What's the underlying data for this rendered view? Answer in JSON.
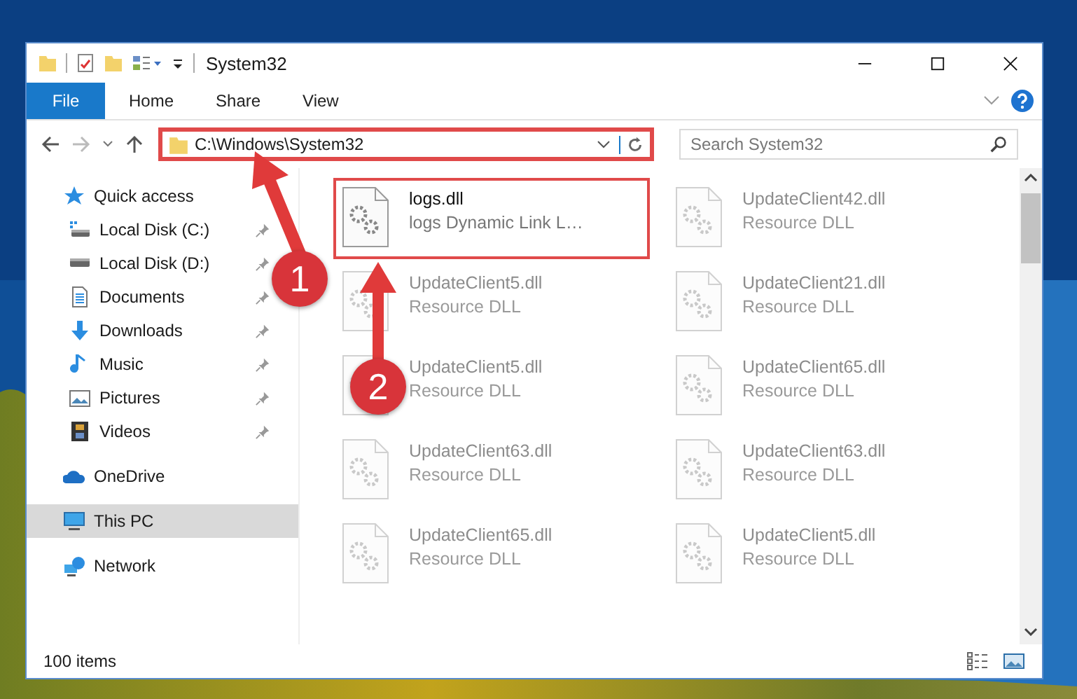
{
  "window": {
    "title": "System32"
  },
  "ribbon_tabs": [
    {
      "label": "File",
      "kind": "file"
    },
    {
      "label": "Home",
      "kind": "tab"
    },
    {
      "label": "Share",
      "kind": "tab"
    },
    {
      "label": "View",
      "kind": "tab"
    }
  ],
  "address": {
    "value": "C:\\Windows\\System32",
    "highlighted": true
  },
  "search": {
    "placeholder": "Search System32"
  },
  "sidebar": {
    "items": [
      {
        "label": "Quick access",
        "selected": false,
        "children": [
          {
            "label": "Local Disk (C:)",
            "pinned": true,
            "selected": false
          },
          {
            "label": "Local Disk (D:)",
            "pinned": true,
            "selected": false
          },
          {
            "label": "Documents",
            "pinned": true,
            "selected": false
          },
          {
            "label": "Downloads",
            "pinned": true,
            "selected": false
          },
          {
            "label": "Music",
            "pinned": true,
            "selected": false
          },
          {
            "label": "Pictures",
            "pinned": true,
            "selected": false
          },
          {
            "label": "Videos",
            "pinned": true,
            "selected": false
          }
        ]
      },
      {
        "label": "OneDrive",
        "selected": false
      },
      {
        "label": "This PC",
        "selected": true
      },
      {
        "label": "Network",
        "selected": false
      }
    ]
  },
  "files": [
    {
      "name": "logs.dll",
      "type": "logs Dynamic Link L…",
      "blurred": false,
      "highlighted": true
    },
    {
      "name": "UpdateClient42.dll",
      "type": "Resource DLL",
      "blurred": true,
      "highlighted": false
    },
    {
      "name": "UpdateClient5.dll",
      "type": "Resource DLL",
      "blurred": true,
      "highlighted": false
    },
    {
      "name": "UpdateClient21.dll",
      "type": "Resource DLL",
      "blurred": true,
      "highlighted": false
    },
    {
      "name": "UpdateClient5.dll",
      "type": "Resource DLL",
      "blurred": true,
      "highlighted": false
    },
    {
      "name": "UpdateClient65.dll",
      "type": "Resource DLL",
      "blurred": true,
      "highlighted": false
    },
    {
      "name": "UpdateClient63.dll",
      "type": "Resource DLL",
      "blurred": true,
      "highlighted": false
    },
    {
      "name": "UpdateClient63.dll",
      "type": "Resource DLL",
      "blurred": true,
      "highlighted": false
    },
    {
      "name": "UpdateClient65.dll",
      "type": "Resource DLL",
      "blurred": true,
      "highlighted": false
    },
    {
      "name": "UpdateClient5.dll",
      "type": "Resource DLL",
      "blurred": true,
      "highlighted": false
    }
  ],
  "annotations": [
    {
      "label": "1"
    },
    {
      "label": "2"
    }
  ],
  "status_bar": {
    "item_count": "100 items"
  }
}
